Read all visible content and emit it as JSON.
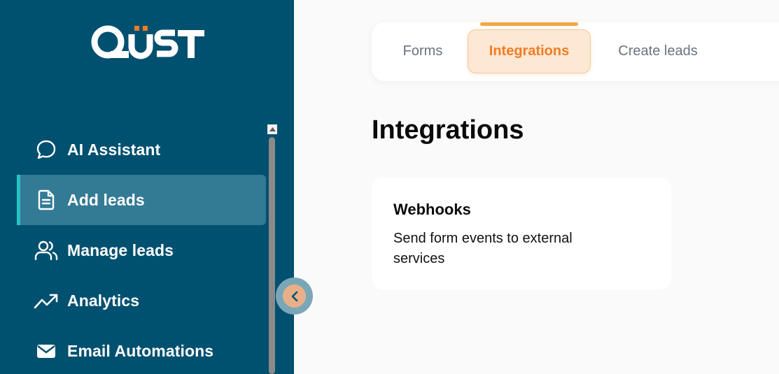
{
  "brand": {
    "logo_text": "QUST",
    "accent_color": "#f07d24",
    "sidebar_color": "#005070"
  },
  "sidebar": {
    "items": [
      {
        "label": "AI Assistant",
        "icon": "chat-bubble-icon",
        "active": false
      },
      {
        "label": "Add leads",
        "icon": "document-icon",
        "active": true
      },
      {
        "label": "Manage leads",
        "icon": "users-icon",
        "active": false
      },
      {
        "label": "Analytics",
        "icon": "trending-up-icon",
        "active": false
      },
      {
        "label": "Email Automations",
        "icon": "envelope-icon",
        "active": false
      }
    ],
    "collapse_icon": "chevron-left-icon"
  },
  "tabs": [
    {
      "label": "Forms",
      "active": false
    },
    {
      "label": "Integrations",
      "active": true
    },
    {
      "label": "Create leads",
      "active": false
    }
  ],
  "main": {
    "title": "Integrations",
    "cards": [
      {
        "title": "Webhooks",
        "description": "Send form events to external services"
      }
    ]
  }
}
